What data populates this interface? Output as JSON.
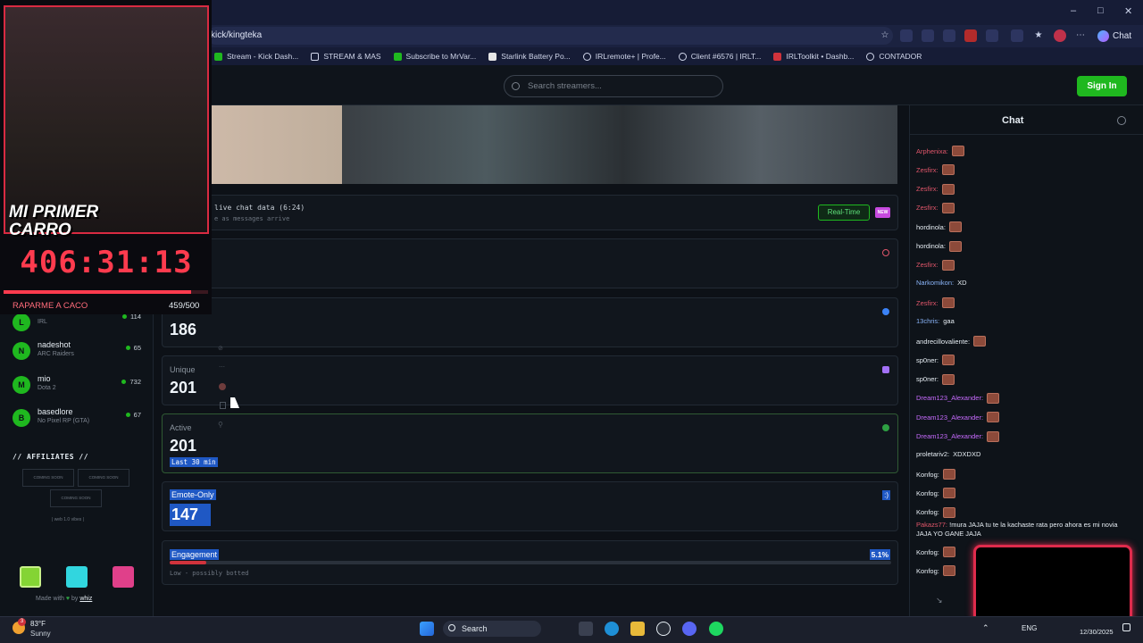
{
  "browser": {
    "url": "kick/kingteka",
    "bookmarks": [
      "Stream - Kick Dash...",
      "STREAM & MAS",
      "Subscribe to MrVar...",
      "Starlink Battery Po...",
      "IRLremote+ | Profe...",
      "Client #6576 | IRLT...",
      "IRLToolkit • Dashb...",
      "CONTADOR"
    ],
    "chat_button": "Chat"
  },
  "header": {
    "search_placeholder": "Search streamers...",
    "sign_in": "Sign In"
  },
  "overlay": {
    "goal_text_line1": "MI PRIMER",
    "goal_text_line2": "CARRO",
    "timer": "406:31:13",
    "goal_name": "RAPARME A CACO",
    "goal_count": "459/500",
    "goal_progress": 0.918
  },
  "sidebar": {
    "streamers": [
      {
        "initial": "L",
        "name": "",
        "game": "IRL",
        "viewers": "114"
      },
      {
        "initial": "N",
        "name": "nadeshot",
        "game": "ARC Raiders",
        "viewers": "65"
      },
      {
        "initial": "M",
        "name": "mio",
        "game": "Dota 2",
        "viewers": "732"
      },
      {
        "initial": "B",
        "name": "basedlore",
        "game": "No Pixel RP (GTA)",
        "viewers": "67"
      }
    ],
    "affiliates_title": "// AFFILIATES //",
    "coming_soon": "COMING SOON",
    "aff_note": "| web 1.0 vibes |",
    "made_with": "Made with",
    "by": "by",
    "author": "whiz"
  },
  "stats": {
    "live_label": "live chat data (6:24)",
    "live_sub": "e as messages arrive",
    "realtime": "Real-Time",
    "new_badge": "NEW",
    "total_value": "186",
    "unique_label": "Unique",
    "unique_value": "201",
    "active_label": "Active",
    "active_value": "201",
    "active_sub": "Last 30 min",
    "emote_label": "Emote-Only",
    "emote_value": "147",
    "emote_icon": ":)",
    "engagement_label": "Engagement",
    "engagement_pct": "5.1%",
    "engagement_fraction": 0.051,
    "engagement_note": "Low - possibly botted"
  },
  "chat": {
    "title": "Chat",
    "messages": [
      {
        "user": "Arphenixa:",
        "text": "",
        "emote": true,
        "color": "#e0566a"
      },
      {
        "user": "Zesfirx:",
        "text": "",
        "emote": true,
        "color": "#e0566a"
      },
      {
        "user": "Zesfirx:",
        "text": "",
        "emote": true,
        "color": "#e0566a"
      },
      {
        "user": "Zesfirx:",
        "text": "",
        "emote": true,
        "color": "#e0566a"
      },
      {
        "user": "hordinola:",
        "text": "",
        "emote": true,
        "color": "#e6edf3"
      },
      {
        "user": "hordinola:",
        "text": "",
        "emote": true,
        "color": "#e6edf3"
      },
      {
        "user": "Zesfirx:",
        "text": "",
        "emote": true,
        "color": "#e0566a"
      },
      {
        "user": "Narkomikon:",
        "text": "XD",
        "emote": false,
        "color": "#8ab4f8"
      },
      {
        "user": "Zesfirx:",
        "text": "",
        "emote": true,
        "color": "#e0566a"
      },
      {
        "user": "13chris:",
        "text": "gaa",
        "emote": false,
        "color": "#8ab4f8"
      },
      {
        "user": "andrecillovaliente:",
        "text": "",
        "emote": true,
        "color": "#e6edf3"
      },
      {
        "user": "sp0ner:",
        "text": "",
        "emote": true,
        "color": "#e6edf3"
      },
      {
        "user": "sp0ner:",
        "text": "",
        "emote": true,
        "color": "#e6edf3"
      },
      {
        "user": "Dream123_Alexander:",
        "text": "",
        "emote": true,
        "color": "#c86bff"
      },
      {
        "user": "Dream123_Alexander:",
        "text": "",
        "emote": true,
        "color": "#c86bff"
      },
      {
        "user": "Dream123_Alexander:",
        "text": "",
        "emote": true,
        "color": "#c86bff"
      },
      {
        "user": "proletariv2:",
        "text": "XDXDXD",
        "emote": false,
        "color": "#e6edf3"
      },
      {
        "user": "Konfog:",
        "text": "",
        "emote": true,
        "color": "#e6edf3"
      },
      {
        "user": "Konfog:",
        "text": "",
        "emote": true,
        "color": "#e6edf3"
      },
      {
        "user": "Konfog:",
        "text": "",
        "emote": true,
        "color": "#e6edf3"
      }
    ],
    "long_user": "Pakazs77:",
    "long_text": "!mura JAJA tu te la kachaste rata pero ahora es mi novia JAJA YO GANE JAJA",
    "tail_messages": [
      {
        "user": "Konfog:",
        "emote": true
      },
      {
        "user": "Konfog:",
        "emote": true
      }
    ]
  },
  "taskbar": {
    "weather_temp": "83°F",
    "weather_desc": "Sunny",
    "weather_badge": "3",
    "search": "Search",
    "lang": "ENG",
    "date": "12/30/2025"
  }
}
